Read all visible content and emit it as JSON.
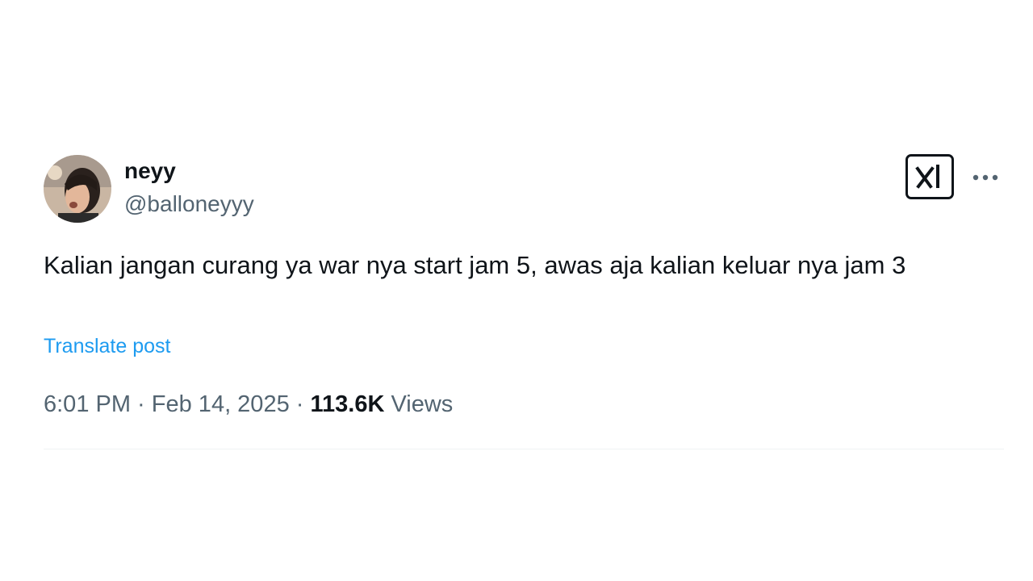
{
  "post": {
    "author": {
      "display_name": "neyy",
      "handle": "@balloneyyy",
      "avatar_icon": "profile-photo"
    },
    "text": "Kalian jangan curang ya war nya start jam 5, awas aja kalian keluar nya jam 3",
    "translate_label": "Translate post",
    "time": "6:01 PM",
    "separator": " · ",
    "date": "Feb 14, 2025",
    "views_count": "113.6K",
    "views_label": "Views",
    "grok_icon": "grok-icon",
    "more_icon": "more-horizontal-icon"
  },
  "colors": {
    "primary_text": "#0f1419",
    "secondary_text": "#536471",
    "link": "#1d9bf0",
    "background": "#ffffff"
  }
}
